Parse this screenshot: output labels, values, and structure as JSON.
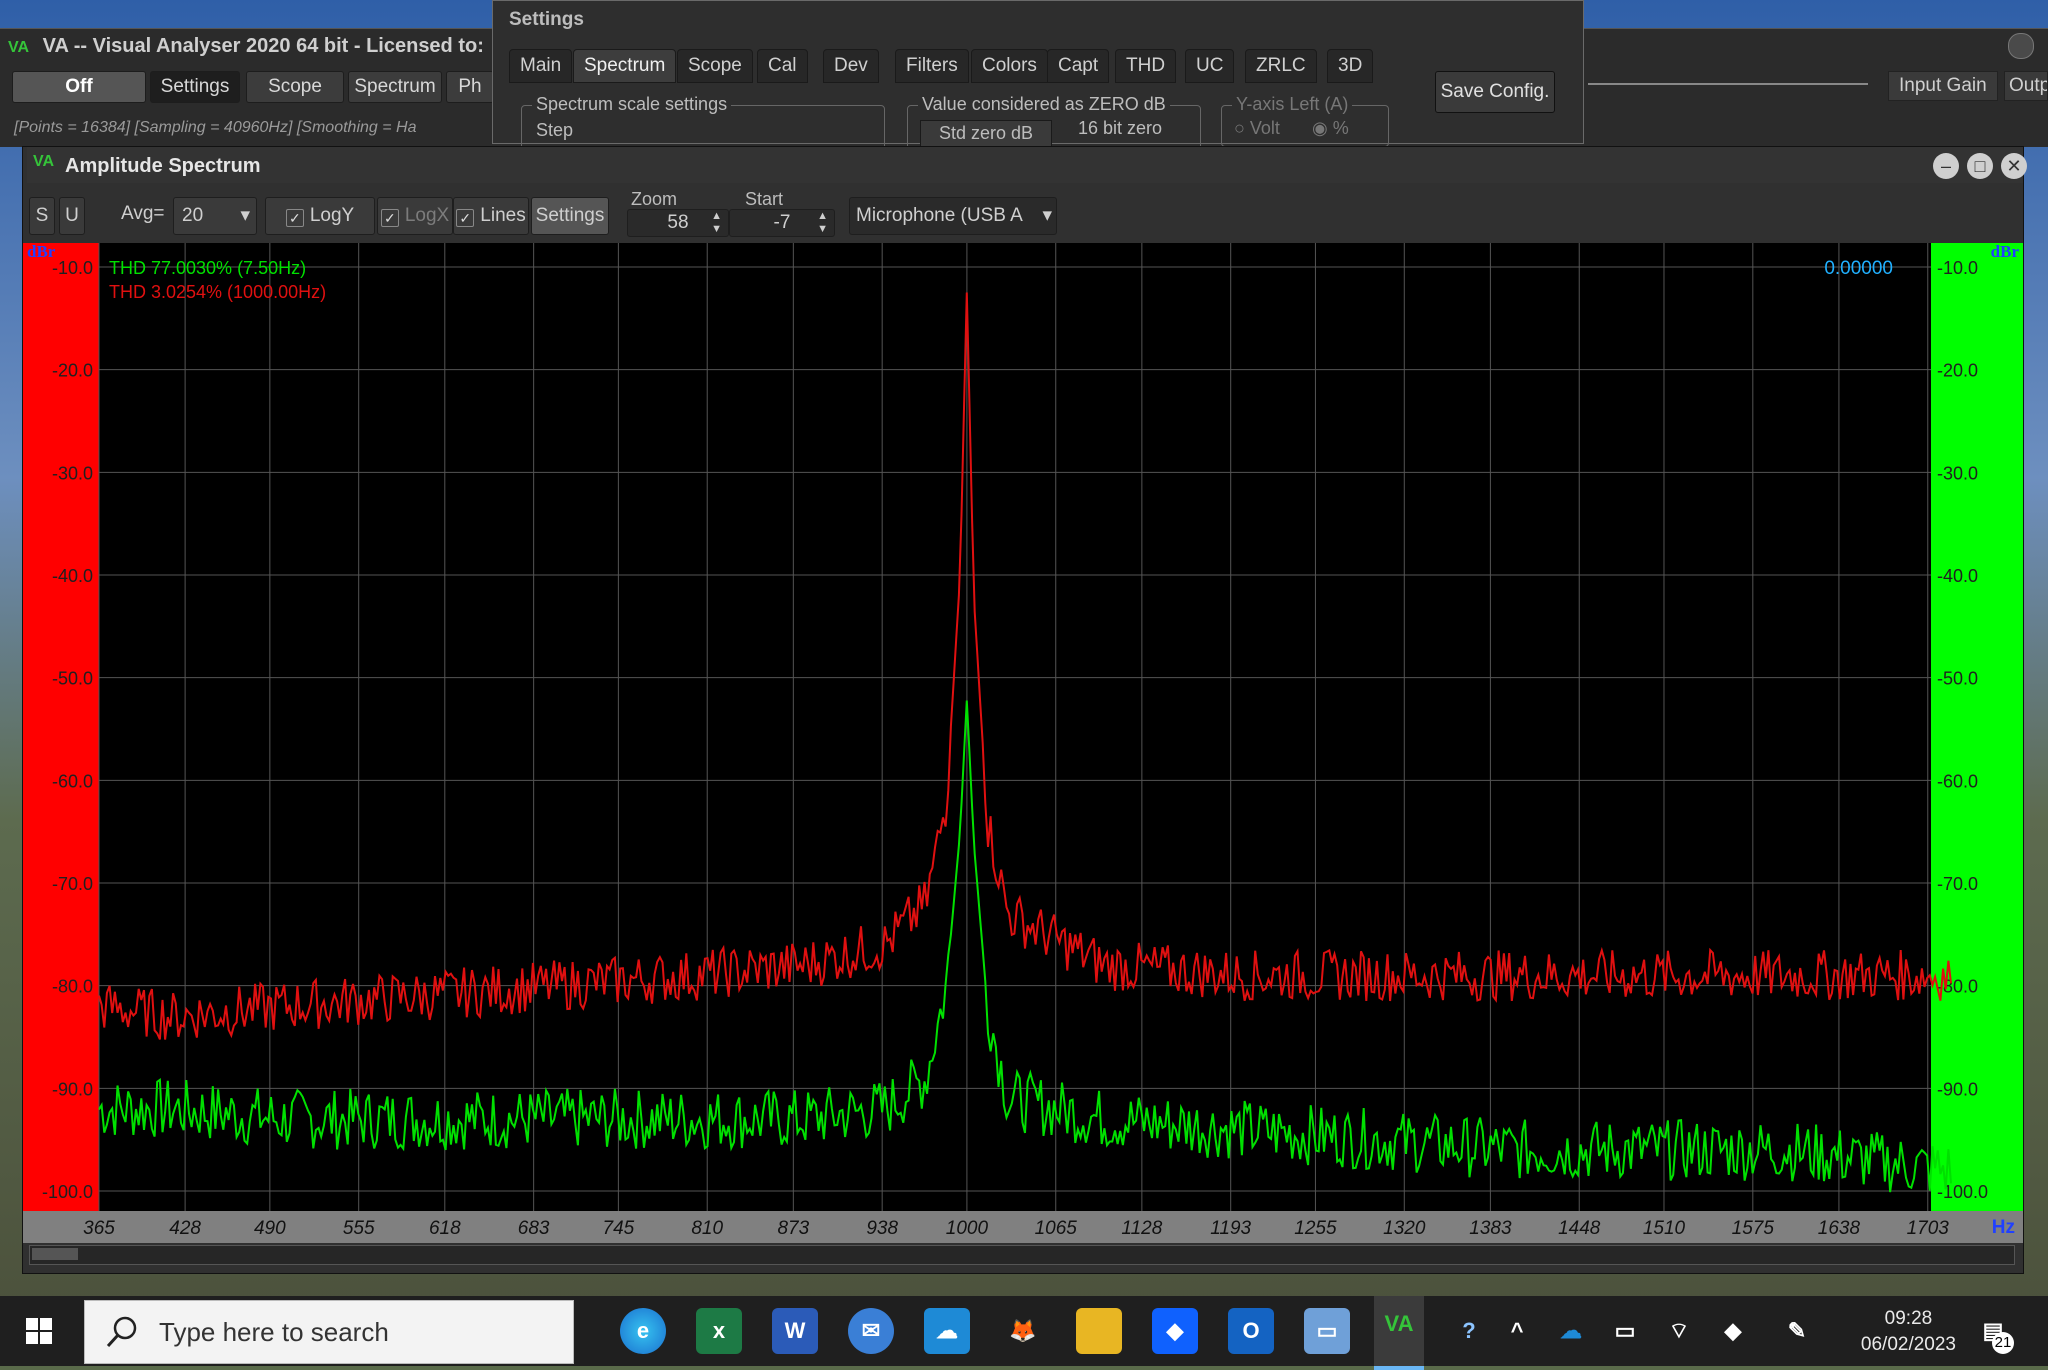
{
  "main_window": {
    "title": "VA -- Visual Analyser 2020 64 bit - Licensed to:",
    "logo": "VA",
    "buttons": [
      "Off",
      "Settings",
      "Scope",
      "Spectrum",
      "Ph"
    ],
    "status": "[Points = 16384]  [Sampling = 40960Hz]  [Smoothing = Ha",
    "right_buttons": [
      "Input Gain",
      "Outp"
    ]
  },
  "settings_window": {
    "title": "Settings",
    "tabs": [
      "Main",
      "Spectrum",
      "Scope",
      "Cal",
      "Dev",
      "Filters",
      "Colors",
      "Capt",
      "THD",
      "UC",
      "ZRLC",
      "3D"
    ],
    "active_tab": "Spectrum",
    "group_scale": {
      "legend": "Spectrum scale settings",
      "step_label": "Step"
    },
    "group_zero": {
      "legend": "Value considered as ZERO dB",
      "std_label": "Std zero dB",
      "bit_label": "16 bit zero"
    },
    "group_yaxis": {
      "legend": "Y-axis Left (A)",
      "volt_label": "Volt",
      "pct_label": "%"
    },
    "save_label": "Save Config."
  },
  "amp_window": {
    "title": "Amplitude Spectrum",
    "logo": "VA",
    "controls": {
      "s_label": "S",
      "u_label": "U",
      "avg_label": "Avg=",
      "avg_value": "20",
      "logy_label": "LogY",
      "logx_label": "LogX",
      "lines_label": "Lines",
      "settings_label": "Settings",
      "zoom_label": "Zoom",
      "zoom_value": "58",
      "start_label": "Start",
      "start_value": "-7",
      "device": "Microphone (USB A"
    }
  },
  "chart_data": {
    "type": "line",
    "xlabel": "Hz",
    "ylabel_left": "dBr",
    "ylabel_right": "dBr",
    "x_ticks": [
      "365",
      "428",
      "490",
      "555",
      "618",
      "683",
      "745",
      "810",
      "873",
      "938",
      "1000",
      "1065",
      "1128",
      "1193",
      "1255",
      "1320",
      "1383",
      "1448",
      "1510",
      "1575",
      "1638",
      "1703"
    ],
    "y_ticks": [
      "-10.0",
      "-20.0",
      "-30.0",
      "-40.0",
      "-50.0",
      "-60.0",
      "-70.0",
      "-80.0",
      "-90.0",
      "-100.0"
    ],
    "xlim": [
      365,
      1720
    ],
    "ylim": [
      -105,
      -10
    ],
    "readout": "0.00000",
    "series": [
      {
        "name": "THD 77.0030% (7.50Hz)",
        "color": "#00e000",
        "x": [
          365,
          420,
          500,
          600,
          700,
          800,
          880,
          940,
          970,
          985,
          995,
          1000,
          1005,
          1015,
          1030,
          1100,
          1200,
          1300,
          1400,
          1500,
          1600,
          1720
        ],
        "y": [
          -92,
          -92,
          -93,
          -93,
          -93,
          -93,
          -93,
          -92,
          -89,
          -80,
          -65,
          -52,
          -66,
          -82,
          -91,
          -93,
          -94,
          -95,
          -96,
          -96,
          -96,
          -98
        ]
      },
      {
        "name": "THD 3.0254% (1000.00Hz)",
        "color": "#e01010",
        "x": [
          365,
          420,
          500,
          600,
          700,
          800,
          880,
          940,
          970,
          985,
          995,
          1000,
          1005,
          1015,
          1030,
          1100,
          1200,
          1300,
          1400,
          1500,
          1600,
          1720
        ],
        "y": [
          -82,
          -83,
          -82,
          -81,
          -80,
          -79,
          -78,
          -76,
          -72,
          -62,
          -40,
          -12,
          -42,
          -64,
          -73,
          -78,
          -79,
          -79,
          -79,
          -79,
          -79,
          -79
        ]
      }
    ]
  },
  "taskbar": {
    "search_placeholder": "Type here to search",
    "time": "09:28",
    "date": "06/02/2023",
    "notification_count": "21",
    "icons": [
      "edge-icon",
      "excel-icon",
      "word-icon",
      "mail-icon",
      "onedrive-app-icon",
      "fox-icon",
      "file-explorer-icon",
      "dropbox-icon",
      "outlook-icon",
      "photos-icon",
      "visual-analyser-icon"
    ]
  }
}
